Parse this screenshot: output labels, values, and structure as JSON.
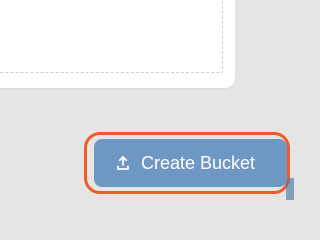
{
  "actions": {
    "create_bucket_label": "Create Bucket"
  },
  "icons": {
    "upload": "upload-icon"
  },
  "colors": {
    "background": "#e5e5e5",
    "button": "#6e98c3",
    "highlight": "#f05a28"
  }
}
